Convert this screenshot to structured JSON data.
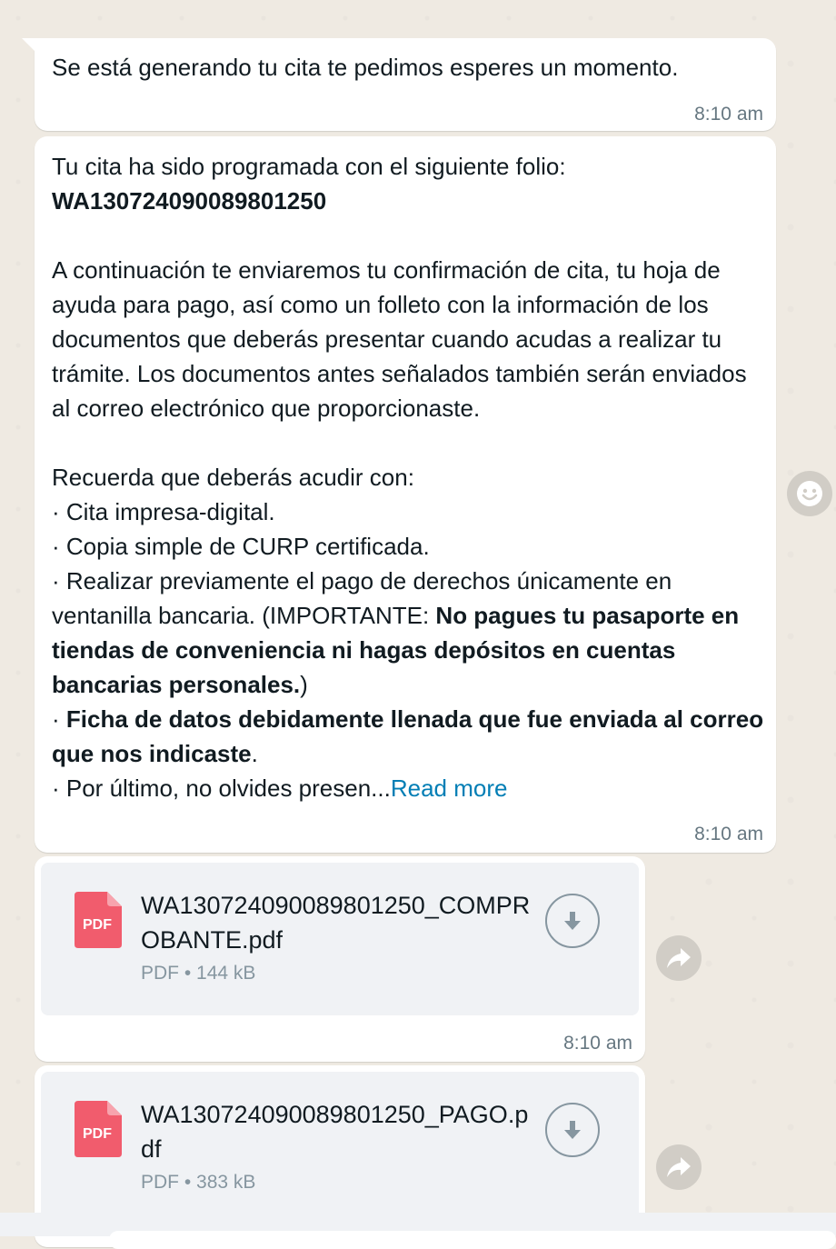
{
  "messages": {
    "m1": {
      "text": "Se está generando tu cita te pedimos esperes un momento.",
      "time": "8:10 am"
    },
    "m2": {
      "line1": "Tu cita ha sido programada con el siguiente folio:",
      "folio": "WA130724090089801250",
      "para": "A continuación te enviaremos tu confirmación de cita, tu hoja de ayuda para pago, así como un folleto con la información de los documentos que deberás presentar cuando acudas a realizar tu trámite. Los documentos antes señalados también serán enviados al correo electrónico que proporcionaste.",
      "recuerda": "Recuerda que deberás acudir con:",
      "item1": "· Cita impresa-digital.",
      "item2": "· Copia simple de CURP certificada.",
      "item3_a": "· Realizar previamente el pago de derechos únicamente en ventanilla bancaria. (IMPORTANTE: ",
      "item3_bold": "No pagues tu pasaporte en tiendas de conveniencia ni hagas depósitos en cuentas bancarias personales.",
      "item3_c": ")",
      "item4_a": "· ",
      "item4_bold": "Ficha de datos debidamente llenada que fue enviada al correo que nos indicaste",
      "item4_c": ".",
      "item5": "· Por último, no olvides presen...",
      "read_more": "Read more",
      "time": "8:10 am"
    },
    "doc1": {
      "name": "WA130724090089801250_COMPROBANTE.pdf",
      "meta": "PDF • 144 kB",
      "icon_label": "PDF",
      "time": "8:10 am"
    },
    "doc2": {
      "name": "WA130724090089801250_PAGO.pdf",
      "meta": "PDF • 383 kB",
      "icon_label": "PDF"
    }
  },
  "icons": {
    "pdf": "pdf-file-icon",
    "download": "download-icon",
    "forward": "forward-icon",
    "emoji": "emoji-icon"
  },
  "colors": {
    "background": "#efeae2",
    "bubble": "#ffffff",
    "link": "#027eb5",
    "pdf_red": "#f15c6d",
    "meta": "#8696a0"
  }
}
